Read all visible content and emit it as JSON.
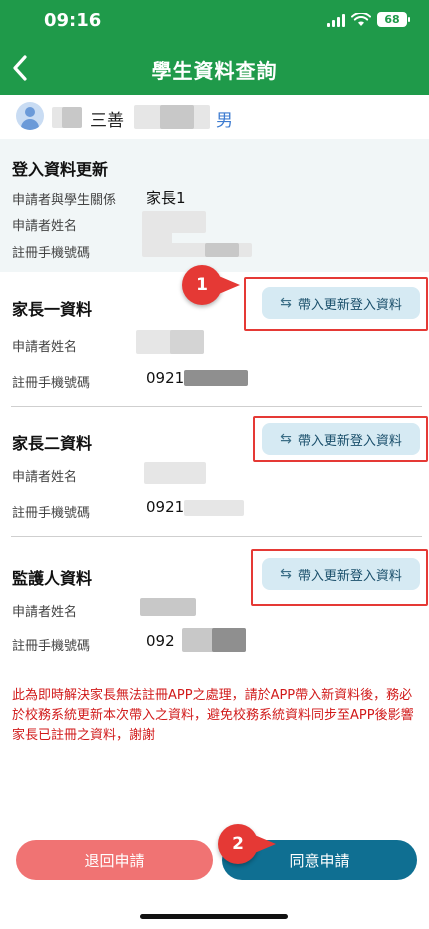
{
  "status_bar": {
    "time": "09:16",
    "battery": "68"
  },
  "header": {
    "title": "學生資料查詢"
  },
  "student": {
    "name_suffix": "三善",
    "gender": "男"
  },
  "login_section": {
    "title": "登入資料更新",
    "relation_label": "申請者與學生關係",
    "relation_value": "家長1",
    "name_label": "申請者姓名",
    "phone_label": "註冊手機號碼"
  },
  "import_button_label": "帶入更新登入資料",
  "parent1": {
    "title": "家長一資料",
    "name_label": "申請者姓名",
    "phone_label": "註冊手機號碼",
    "phone_prefix": "0921"
  },
  "parent2": {
    "title": "家長二資料",
    "name_label": "申請者姓名",
    "phone_label": "註冊手機號碼",
    "phone_prefix": "0921"
  },
  "guardian": {
    "title": "監護人資料",
    "name_label": "申請者姓名",
    "phone_label": "註冊手機號碼",
    "phone_prefix": "092"
  },
  "notice": "此為即時解決家長無法註冊APP之處理，請於APP帶入新資料後，務必於校務系統更新本次帶入之資料，避免校務系統資料同步至APP後影響家長已註冊之資料，謝謝",
  "buttons": {
    "reject": "退回申請",
    "agree": "同意申請"
  },
  "callouts": {
    "first": "1",
    "second": "2"
  },
  "colors": {
    "header": "#1f9a4a",
    "annotation": "#e53935",
    "reject": "#f07373",
    "agree": "#0f6f92",
    "notice": "#d11a1a"
  }
}
